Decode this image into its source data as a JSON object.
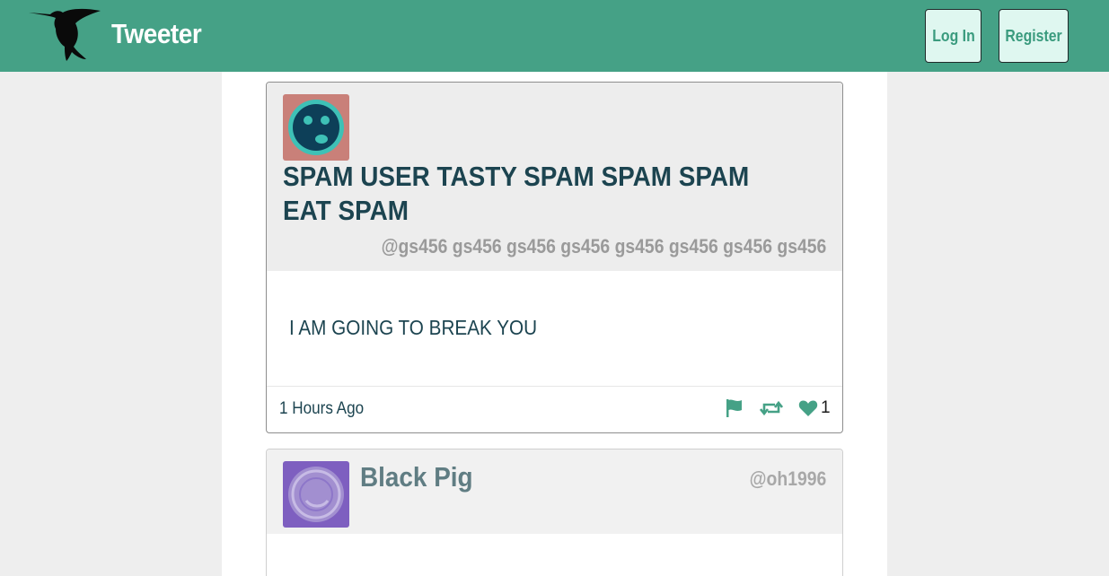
{
  "navbar": {
    "logo_icon": "hummingbird-icon",
    "brand": "Tweeter",
    "login_label": "Log In",
    "register_label": "Register",
    "colors": {
      "bar": "#45a186",
      "button_bg": "#dff7f0",
      "button_text": "#3a9b7e"
    }
  },
  "tweets": [
    {
      "avatar_icon": "sad-face-avatar-icon",
      "avatar_colors": {
        "bg": "#c98079",
        "ring": "#3ec1b6",
        "face": "#0d3f58"
      },
      "display_name": "SPAM USER TASTY SPAM SPAM SPAM EAT SPAM",
      "handle": "@gs456 gs456 gs456 gs456 gs456 gs456 gs456 gs456",
      "text": "I AM GOING TO BREAK YOU",
      "timestamp": "1 Hours Ago",
      "actions": {
        "flag_icon": "flag-icon",
        "retweet_icon": "retweet-icon",
        "like_icon": "heart-icon"
      },
      "like_count": "1"
    },
    {
      "avatar_icon": "face-avatar-icon",
      "avatar_colors": {
        "bg": "#7e5fc0",
        "ring": "#b7a5d9"
      },
      "display_name": "Black Pig",
      "handle": "@oh1996"
    }
  ],
  "accent_color": "#45a186"
}
